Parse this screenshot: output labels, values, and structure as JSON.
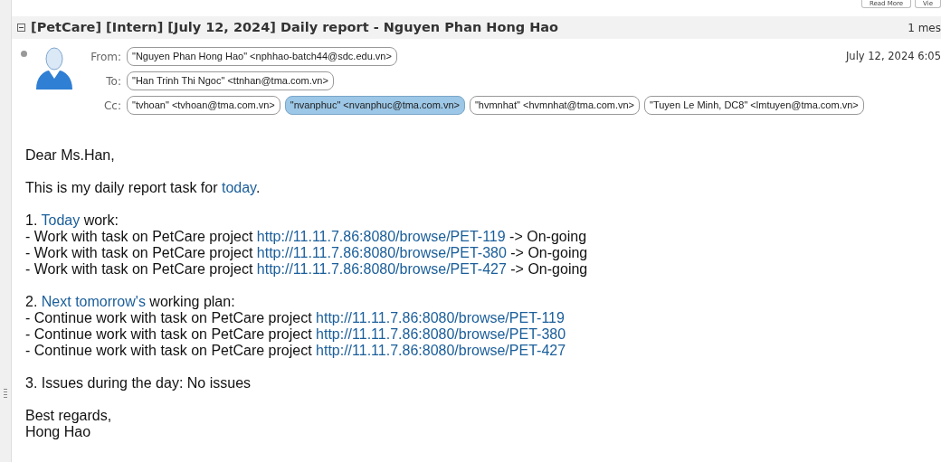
{
  "toolbar": {
    "buttons": [
      "Read More",
      "Vie"
    ]
  },
  "thread": {
    "subject": "[PetCare] [Intern] [July 12, 2024] Daily report - Nguyen Phan Hong Hao",
    "count": "1 mes"
  },
  "message": {
    "date": "July 12, 2024 6:05",
    "fields": [
      {
        "label": "From:",
        "chips": [
          {
            "text": "\"Nguyen Phan Hong Hao\" <nphhao-batch44@sdc.edu.vn>",
            "selected": false
          }
        ]
      },
      {
        "label": "To:",
        "chips": [
          {
            "text": "\"Han Trinh Thi Ngoc\" <ttnhan@tma.com.vn>",
            "selected": false
          }
        ]
      },
      {
        "label": "Cc:",
        "chips": [
          {
            "text": "\"tvhoan\" <tvhoan@tma.com.vn>",
            "selected": false
          },
          {
            "text": "\"nvanphuc\" <nvanphuc@tma.com.vn>",
            "selected": true
          },
          {
            "text": "\"hvmnhat\" <hvmnhat@tma.com.vn>",
            "selected": false
          },
          {
            "text": "\"Tuyen Le Minh, DC8\" <lmtuyen@tma.com.vn>",
            "selected": false
          }
        ]
      }
    ],
    "body": [
      [
        [
          {
            "text": "Dear Ms.Han,",
            "link": false
          }
        ]
      ],
      [
        [
          {
            "text": "This is my daily report task for ",
            "link": false
          },
          {
            "text": "today",
            "link": true
          },
          {
            "text": ".",
            "link": false
          }
        ]
      ],
      [
        [
          {
            "text": "1. ",
            "link": false
          },
          {
            "text": "Today",
            "link": true
          },
          {
            "text": " work:",
            "link": false
          }
        ],
        [
          {
            "text": "- Work with task on PetCare project ",
            "link": false
          },
          {
            "text": "http://11.11.7.86:8080/browse/PET-119",
            "link": true
          },
          {
            "text": " -> On-going",
            "link": false
          }
        ],
        [
          {
            "text": "- Work with task on PetCare project ",
            "link": false
          },
          {
            "text": "http://11.11.7.86:8080/browse/PET-380",
            "link": true
          },
          {
            "text": " -> On-going",
            "link": false
          }
        ],
        [
          {
            "text": "- Work with task on PetCare project ",
            "link": false
          },
          {
            "text": "http://11.11.7.86:8080/browse/PET-427",
            "link": true
          },
          {
            "text": " -> On-going",
            "link": false
          }
        ]
      ],
      [
        [
          {
            "text": "2. ",
            "link": false
          },
          {
            "text": "Next tomorrow's",
            "link": true
          },
          {
            "text": " working plan:",
            "link": false
          }
        ],
        [
          {
            "text": "- Continue work with task on PetCare project ",
            "link": false
          },
          {
            "text": "http://11.11.7.86:8080/browse/PET-119",
            "link": true
          }
        ],
        [
          {
            "text": "- Continue work with task on PetCare project ",
            "link": false
          },
          {
            "text": "http://11.11.7.86:8080/browse/PET-380",
            "link": true
          }
        ],
        [
          {
            "text": "- Continue work with task on PetCare project ",
            "link": false
          },
          {
            "text": "http://11.11.7.86:8080/browse/PET-427",
            "link": true
          }
        ]
      ],
      [
        [
          {
            "text": "3. Issues during the day: No issues",
            "link": false
          }
        ]
      ],
      [
        [
          {
            "text": "Best regards,",
            "link": false
          }
        ],
        [
          {
            "text": "Hong Hao",
            "link": false
          }
        ]
      ]
    ]
  }
}
